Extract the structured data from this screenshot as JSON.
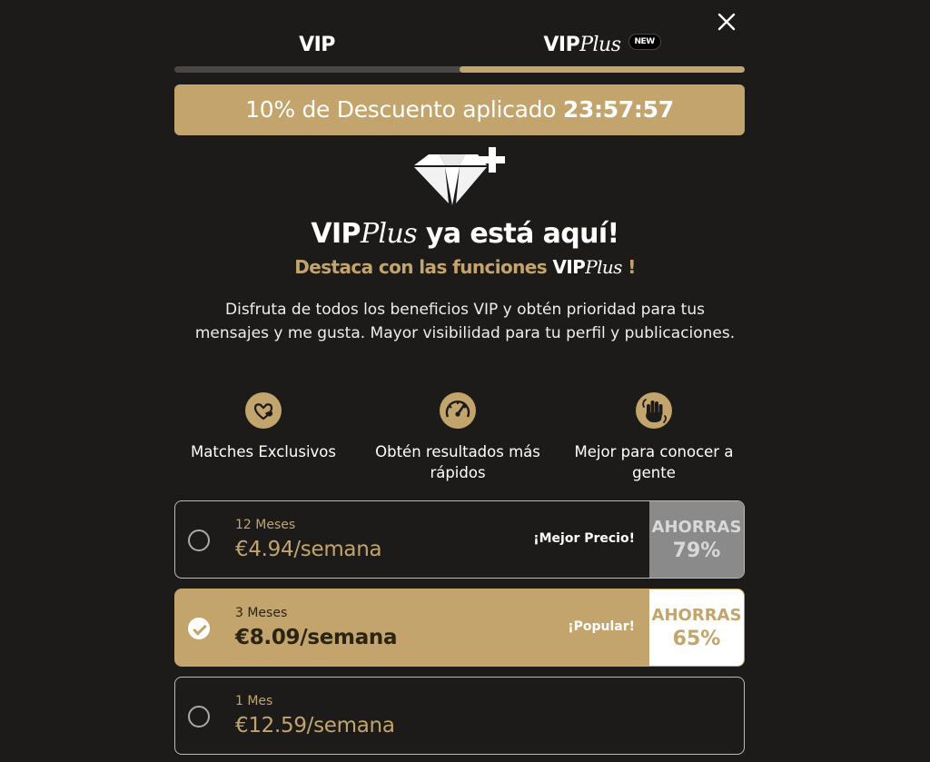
{
  "tabs": [
    {
      "label": "VIP",
      "active": false
    },
    {
      "label_main": "VIP",
      "label_italic": "Plus",
      "badge": "NEW",
      "active": true
    }
  ],
  "discount": {
    "text": "10% de Descuento aplicado",
    "timer": "23:57:57"
  },
  "headline": {
    "brand": "VIP",
    "brand_italic": "Plus",
    "rest": "ya está aquí!"
  },
  "subheadline": {
    "text": "Destaca con las funciones",
    "brand": "VIP",
    "brand_italic": "Plus",
    "end": "!"
  },
  "description": "Disfruta de todos los beneficios VIP y obtén prioridad para tus mensajes y me gusta. Mayor visibilidad para tu perfil y publicaciones.",
  "features": [
    {
      "icon": "heart-icon",
      "label": "Matches Exclusivos"
    },
    {
      "icon": "speedometer-icon",
      "label": "Obtén resultados más rápidos"
    },
    {
      "icon": "hand-wave-icon",
      "label": "Mejor para conocer a gente"
    }
  ],
  "plans": [
    {
      "duration": "12 Meses",
      "price": "€4.94/semana",
      "tag": "¡Mejor Precio!",
      "savings_label": "AHORRAS",
      "savings_value": "79%",
      "selected": false
    },
    {
      "duration": "3 Meses",
      "price": "€8.09/semana",
      "tag": "¡Popular!",
      "savings_label": "AHORRAS",
      "savings_value": "65%",
      "selected": true
    },
    {
      "duration": "1 Mes",
      "price": "€12.59/semana",
      "selected": false
    }
  ],
  "colors": {
    "accent": "#c2a46c",
    "background": "#1c1b1a",
    "savings_gray": "#8a8a8a"
  }
}
